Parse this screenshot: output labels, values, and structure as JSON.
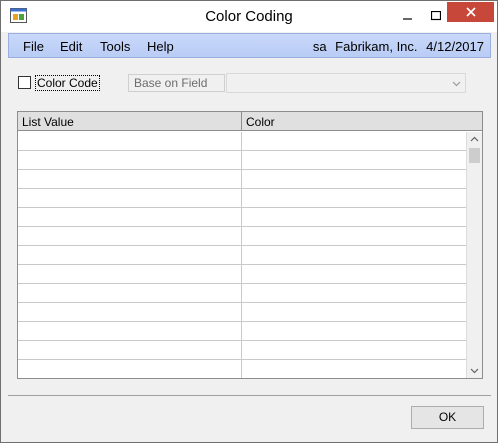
{
  "window": {
    "title": "Color Coding"
  },
  "menu": {
    "items": [
      "File",
      "Edit",
      "Tools",
      "Help"
    ]
  },
  "user_info": {
    "user": "sa",
    "company": "Fabrikam, Inc.",
    "date": "4/12/2017"
  },
  "filters": {
    "color_code_label": "Color Code",
    "color_code_checked": false,
    "base_on_field_label": "Base on Field",
    "base_on_field_value": ""
  },
  "grid": {
    "columns": [
      "List Value",
      "Color"
    ],
    "rows": [
      [
        "",
        ""
      ],
      [
        "",
        ""
      ],
      [
        "",
        ""
      ],
      [
        "",
        ""
      ],
      [
        "",
        ""
      ],
      [
        "",
        ""
      ],
      [
        "",
        ""
      ],
      [
        "",
        ""
      ],
      [
        "",
        ""
      ],
      [
        "",
        ""
      ],
      [
        "",
        ""
      ],
      [
        "",
        ""
      ],
      [
        "",
        ""
      ]
    ]
  },
  "buttons": {
    "ok_label": "OK"
  },
  "icons": {
    "app": "app-icon",
    "minimize": "minimize-icon",
    "maximize": "maximize-icon",
    "close": "close-icon",
    "dropdown": "chevron-down-icon"
  },
  "colors": {
    "menubar": "#c9d8fb",
    "close_button": "#c7473a",
    "window_bg": "#f0f0f0"
  }
}
